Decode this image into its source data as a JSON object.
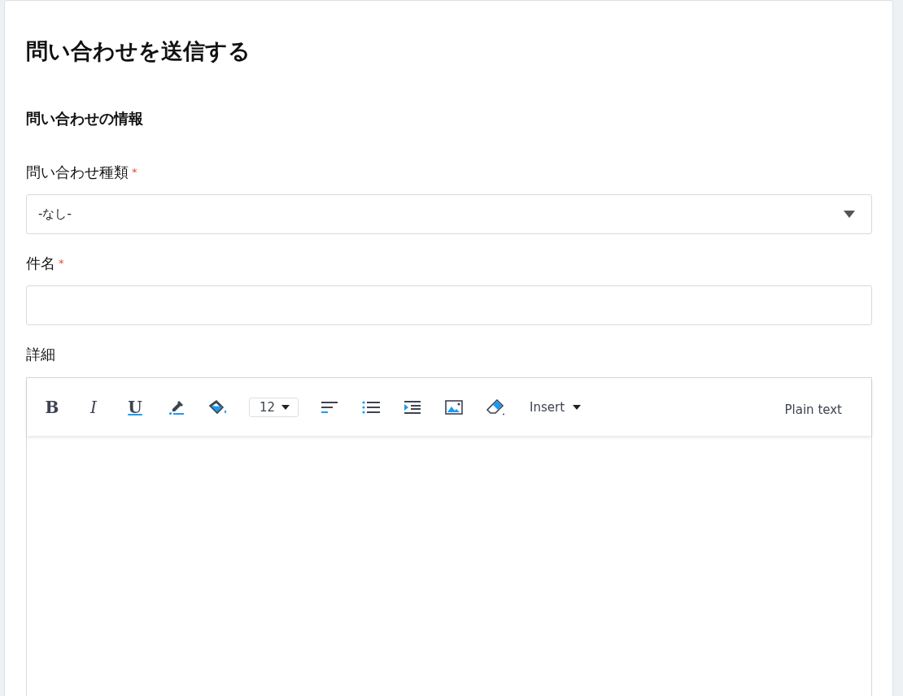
{
  "title": "問い合わせを送信する",
  "section": "問い合わせの情報",
  "fields": [
    {
      "kind": "select",
      "label": "問い合わせ種類",
      "required_mark": "*",
      "value": "-なし-"
    },
    {
      "kind": "text",
      "label": "件名",
      "required_mark": "*"
    },
    {
      "kind": "editor",
      "label": "詳細"
    }
  ],
  "toolbar": [
    {
      "kind": "bold",
      "label": "B"
    },
    {
      "kind": "italic",
      "label": "I"
    },
    {
      "kind": "underline",
      "label": "U"
    },
    {
      "kind": "text-color"
    },
    {
      "kind": "fill-color"
    },
    {
      "kind": "font-size",
      "label": "12"
    },
    {
      "kind": "align"
    },
    {
      "kind": "list"
    },
    {
      "kind": "indent"
    },
    {
      "kind": "image"
    },
    {
      "kind": "eraser"
    },
    {
      "kind": "insert",
      "label": "Insert"
    }
  ],
  "mode_label": "Plain text"
}
